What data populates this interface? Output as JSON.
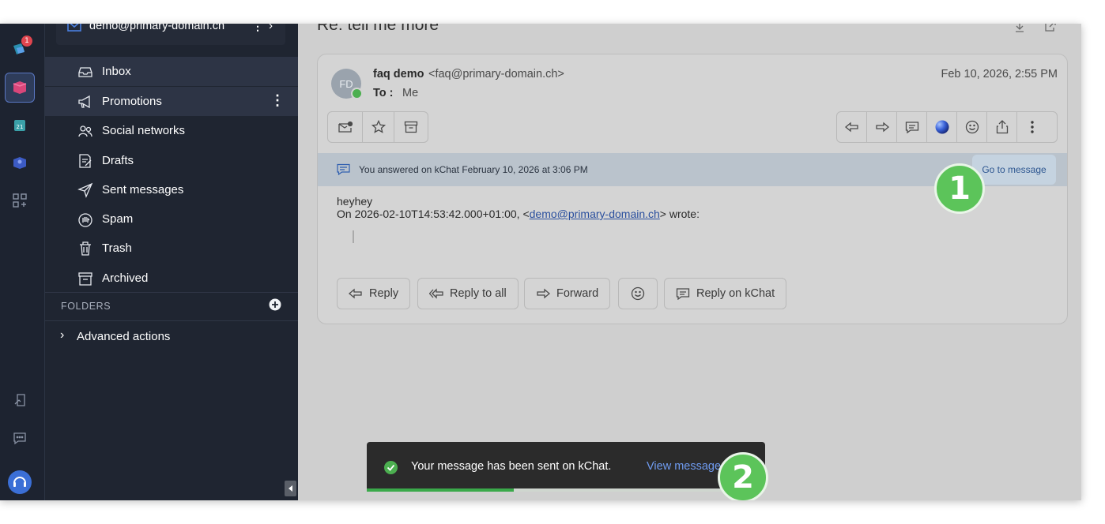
{
  "colors": {
    "accent": "#5cc45a",
    "link": "#2a4f9e",
    "badge": "#e0454f"
  },
  "rail": {
    "notification_count": "1"
  },
  "account": {
    "email": "demo@primary-domain.ch"
  },
  "sidebar": {
    "items": [
      {
        "label": "Inbox",
        "icon": "inbox-icon"
      },
      {
        "label": "Promotions",
        "icon": "megaphone-icon"
      },
      {
        "label": "Social networks",
        "icon": "people-icon"
      },
      {
        "label": "Drafts",
        "icon": "draft-icon"
      },
      {
        "label": "Sent messages",
        "icon": "send-icon"
      },
      {
        "label": "Spam",
        "icon": "spam-icon"
      },
      {
        "label": "Trash",
        "icon": "trash-icon"
      },
      {
        "label": "Archived",
        "icon": "archive-icon"
      }
    ],
    "folders_title": "FOLDERS",
    "advanced_actions": "Advanced actions"
  },
  "message": {
    "subject": "Re: tell me more",
    "avatar_initials": "FD",
    "sender_name": "faq demo",
    "sender_email": "<faq@primary-domain.ch>",
    "to_label": "To :",
    "to_value": "Me",
    "date": "Feb 10, 2026, 2:55 PM",
    "kchat_notice": "You answered on kChat February 10, 2026 at 3:06 PM",
    "go_to_message": "Go to message",
    "body_line1": "heyhey",
    "body_quote_prefix": "On 2026-02-10T14:53:42.000+01:00, <",
    "body_quote_link": "demo@primary-domain.ch",
    "body_quote_suffix": "> wrote:"
  },
  "actions": {
    "reply": "Reply",
    "reply_all": "Reply to all",
    "forward": "Forward",
    "reply_kchat": "Reply on kChat"
  },
  "toast": {
    "text": "Your message has been sent on kChat.",
    "link": "View message",
    "progress": 0.37
  },
  "markers": {
    "one": "1",
    "two": "2"
  }
}
